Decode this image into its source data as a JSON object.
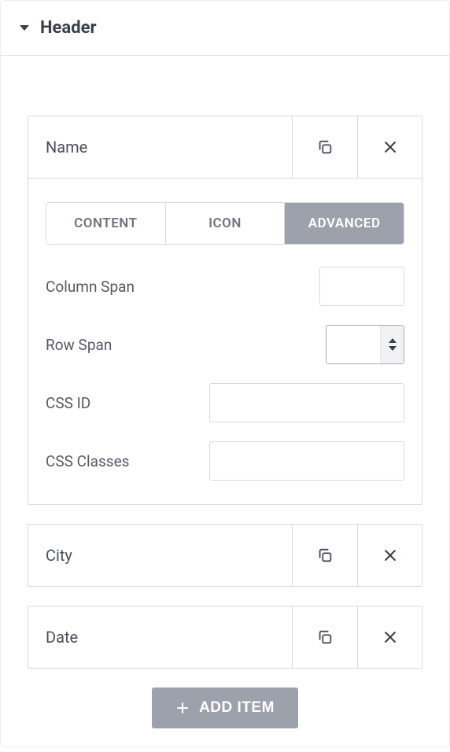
{
  "section": {
    "title": "Header"
  },
  "tabs": {
    "content": "CONTENT",
    "icon": "ICON",
    "advanced": "ADVANCED",
    "active": "advanced"
  },
  "items": [
    {
      "title": "Name",
      "expanded": true,
      "advanced": {
        "column_span_label": "Column Span",
        "column_span_value": "",
        "row_span_label": "Row Span",
        "row_span_value": "",
        "css_id_label": "CSS ID",
        "css_id_value": "",
        "css_classes_label": "CSS Classes",
        "css_classes_value": ""
      }
    },
    {
      "title": "City",
      "expanded": false
    },
    {
      "title": "Date",
      "expanded": false
    }
  ],
  "add_button_label": "ADD ITEM"
}
